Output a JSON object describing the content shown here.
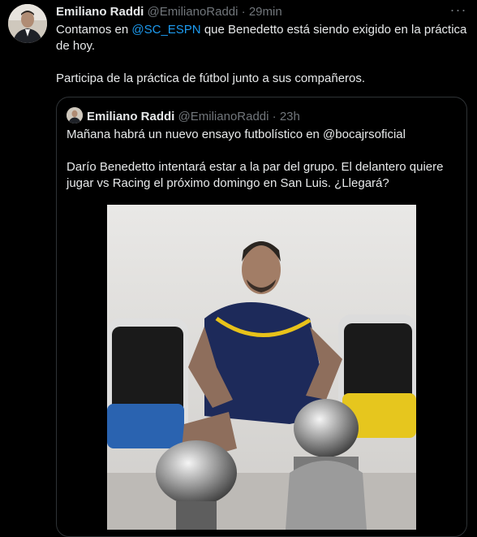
{
  "tweet": {
    "author_name": "Emiliano Raddi",
    "author_handle": "@EmilianoRaddi",
    "separator": "·",
    "time": "29min",
    "more_icon": "more-icon",
    "text_before": "Contamos en ",
    "mention": "@SC_ESPN",
    "text_after": " que Benedetto está siendo exigido en la práctica de hoy.",
    "paragraph2": "Participa de la práctica de fútbol junto a sus compañeros."
  },
  "quoted": {
    "author_name": "Emiliano Raddi",
    "author_handle": "@EmilianoRaddi",
    "separator": "·",
    "time": "23h",
    "paragraph1": "Mañana habrá un nuevo ensayo futbolístico en @bocajrsoficial",
    "paragraph2": "Darío Benedetto intentará estar a la par del grupo. El delantero quiere jugar vs Racing el próximo domingo en San Luis. ¿Llegará?"
  },
  "colors": {
    "background": "#000000",
    "text": "#e7e9ea",
    "secondary": "#71767b",
    "accent": "#1d9bf0",
    "border": "#2f3336"
  }
}
